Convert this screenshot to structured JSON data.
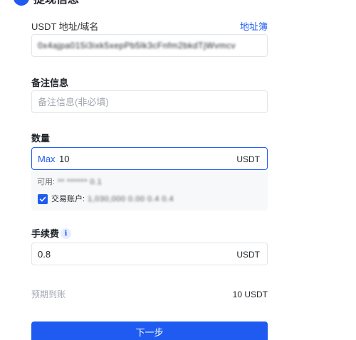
{
  "header": {
    "title": "提现信息"
  },
  "address": {
    "label": "USDT 地址/域名",
    "address_book_link": "地址簿",
    "value": "0x4ajpa015i3ixk5xepPb5lk3cFnfm2bkdTjWvmcv"
  },
  "remark": {
    "label": "备注信息",
    "placeholder": "备注信息(非必填)"
  },
  "amount": {
    "label": "数量",
    "max_label": "Max",
    "value": "10",
    "unit": "USDT",
    "available_prefix": "可用:",
    "available_value": "** ****** 0.1",
    "trading_account_label": "交易账户:",
    "trading_account_value": "1,030,000 0.00 0.4 0.4"
  },
  "fee": {
    "label": "手续费",
    "info_icon": "i",
    "value": "0.8",
    "unit": "USDT"
  },
  "expected": {
    "label": "预期到账",
    "value": "10 USDT"
  },
  "next_button": {
    "label": "下一步"
  },
  "colors": {
    "accent": "#1f5bf0",
    "border": "#e3e5e8",
    "placeholder": "#a3a8b0"
  }
}
